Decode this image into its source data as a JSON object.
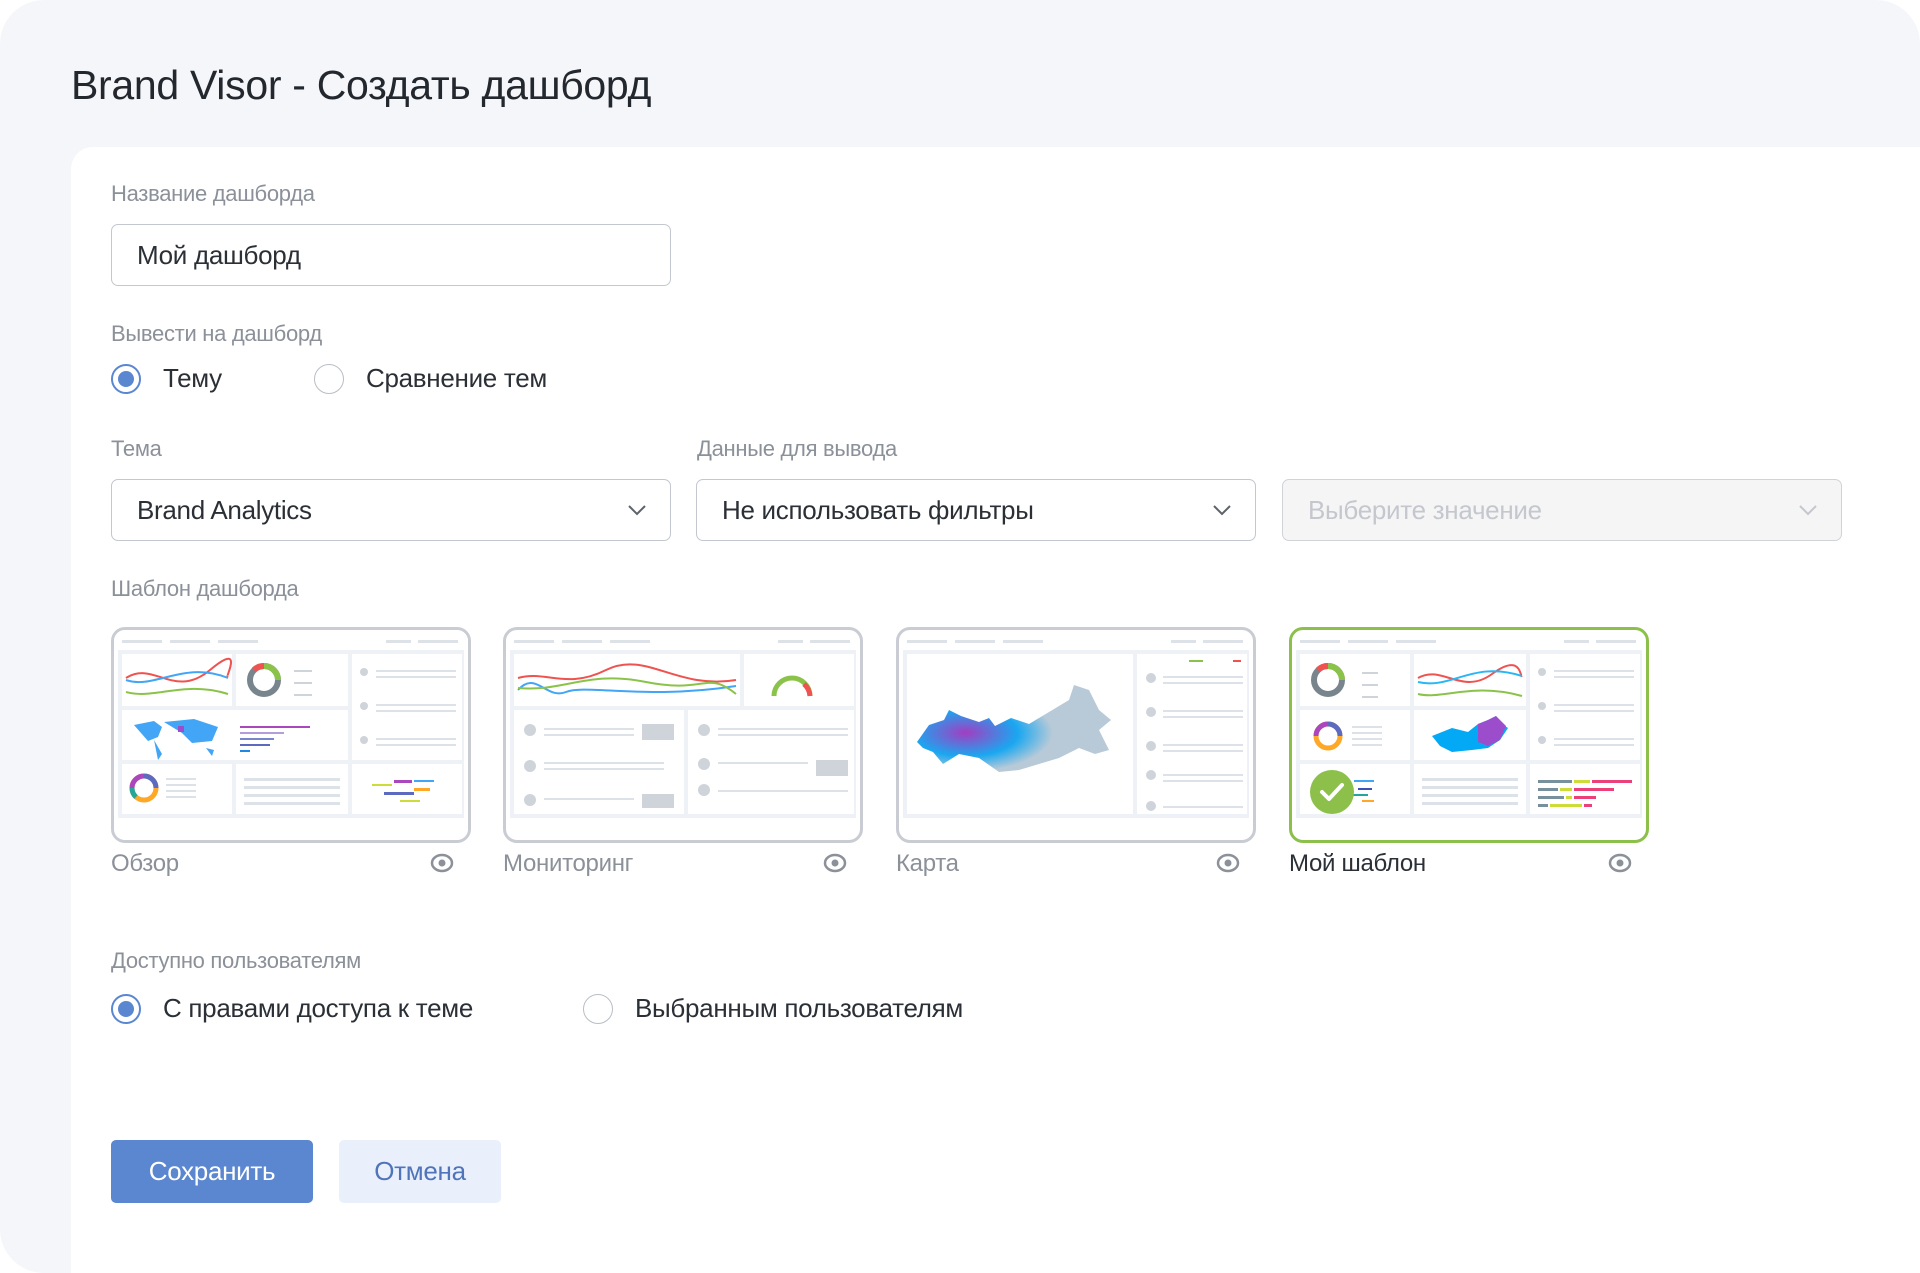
{
  "window": {
    "title": "Brand Visor - Создать дашборд"
  },
  "form": {
    "name": {
      "label": "Название дашборда",
      "value": "Мой дашборд"
    },
    "output": {
      "label": "Вывести на дашборд",
      "options": [
        {
          "label": "Тему",
          "checked": true
        },
        {
          "label": "Сравнение тем",
          "checked": false
        }
      ]
    },
    "topic": {
      "label": "Тема",
      "value": "Brand Analytics"
    },
    "data_output": {
      "label": "Данные для вывода",
      "value": "Не использовать фильтры"
    },
    "value_select": {
      "placeholder": "Выберите значение",
      "disabled": true
    },
    "template": {
      "label": "Шаблон дашборда",
      "items": [
        {
          "label": "Обзор",
          "selected": false,
          "preview_icon": "eye-icon"
        },
        {
          "label": "Мониторинг",
          "selected": false,
          "preview_icon": "eye-icon"
        },
        {
          "label": "Карта",
          "selected": false,
          "preview_icon": "eye-icon"
        },
        {
          "label": "Мой шаблон",
          "selected": true,
          "preview_icon": "eye-icon"
        }
      ]
    },
    "access": {
      "label": "Доступно пользователям",
      "options": [
        {
          "label": "С правами доступа к теме",
          "checked": true
        },
        {
          "label": "Выбранным пользователям",
          "checked": false
        }
      ]
    }
  },
  "actions": {
    "save_label": "Сохранить",
    "cancel_label": "Отмена"
  },
  "colors": {
    "primary": "#5b86d0",
    "selected_border": "#8cc04b",
    "page_bg": "#f5f6fa",
    "label": "#8b9099"
  }
}
